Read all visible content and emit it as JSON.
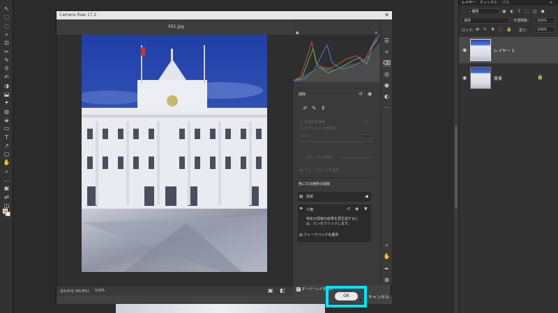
{
  "ps_tools": [
    "↖",
    "⬚",
    "◌",
    "⌕",
    "⊡",
    "✂",
    "✎",
    "⚲",
    "✍",
    "◑",
    "⬓",
    "✦",
    "◍",
    "⬙",
    "▭",
    "T",
    "↗",
    "▢",
    "✋",
    "⌕",
    "…",
    "▣",
    "⇄",
    "◫",
    "⊞"
  ],
  "layers_panel": {
    "tabs": [
      "レイヤー",
      "チャンネル",
      "パス"
    ],
    "search_kind": "種類",
    "blend_mode": "通常",
    "opacity_label": "不透明度：",
    "opacity_value": "100%",
    "lock_label": "ロック：",
    "fill_label": "塗り：",
    "fill_value": "100%",
    "layers": [
      {
        "name": "レイヤー 1"
      },
      {
        "name": "背景"
      }
    ]
  },
  "camera_raw": {
    "title": "Camera Raw 17.2",
    "close_glyph": "✕",
    "filename": "001.jpg",
    "remove_section": {
      "header": "削除",
      "use_generative_ai": "生成AIを使用",
      "detect_objects": "オブジェクトを検出",
      "size_label": "サイズ",
      "show_overlay": "スポットを可視化",
      "feedback": "フィードバックを提供"
    },
    "distractions": {
      "header": "気になる箇所の削除",
      "reflections": "反射",
      "people": "人物",
      "people_hint": "特定の領域の結果を再生成するに\nは、ピンをクリックします。",
      "feedback": "フィードバックを提供"
    },
    "zoom_fit": "合わせる (90.8%)",
    "zoom_100": "100%",
    "show_overlay_checkbox": "オーバーレイを表示",
    "ok_label": "OK",
    "cancel_label": "キャンセル"
  },
  "colors": {
    "highlight": "#00e5ff",
    "histogram_red": "#d24a3f",
    "histogram_green": "#4fb860",
    "histogram_blue": "#4d7ce6"
  }
}
